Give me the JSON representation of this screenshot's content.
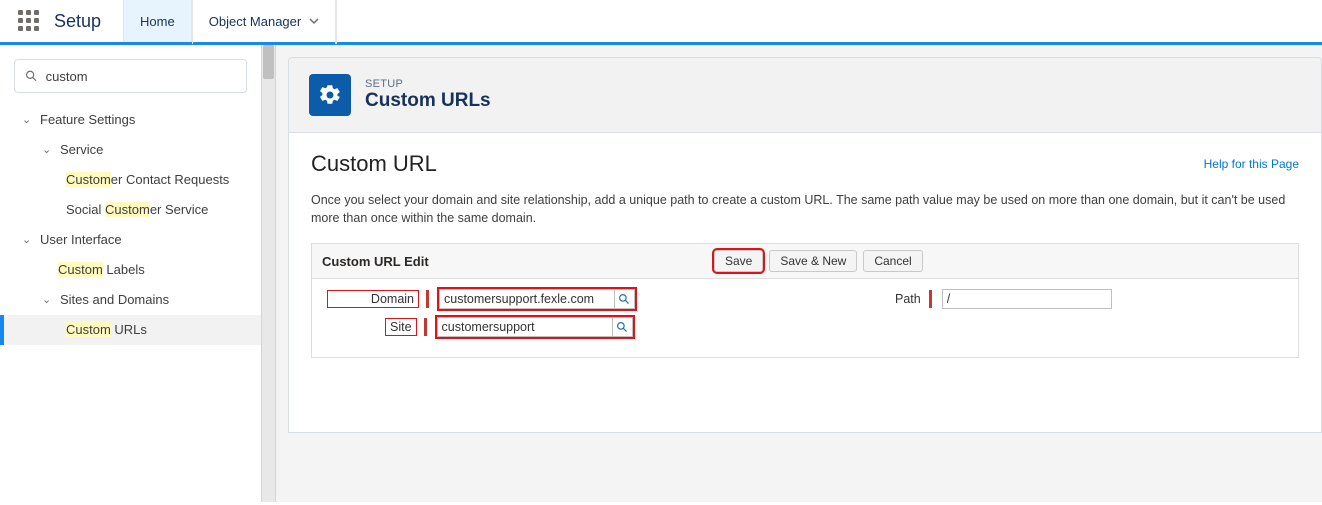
{
  "topbar": {
    "app_title": "Setup",
    "tab_home": "Home",
    "tab_object_manager": "Object Manager"
  },
  "sidebar": {
    "search_value": "custom",
    "tree": {
      "feature_settings": "Feature Settings",
      "service": "Service",
      "customer_contact_pre": "Custom",
      "customer_contact_post": "er Contact Requests",
      "social_pre": "Social ",
      "social_hl": "Custom",
      "social_post": "er Service",
      "user_interface": "User Interface",
      "custom_labels_hl": "Custom",
      "custom_labels_post": " Labels",
      "sites_domains": "Sites and Domains",
      "custom_urls_hl": "Custom",
      "custom_urls_post": " URLs"
    }
  },
  "header": {
    "eyebrow": "SETUP",
    "title": "Custom URLs"
  },
  "detail": {
    "section_title": "Custom URL",
    "help": "Help for this Page",
    "description": "Once you select your domain and site relationship, add a unique path to create a custom URL. The same path value may be used on more than one domain, but it can't be used more than once within the same domain.",
    "edit_title": "Custom URL Edit",
    "buttons": {
      "save": "Save",
      "save_new": "Save & New",
      "cancel": "Cancel"
    },
    "form": {
      "domain_label": "Domain",
      "domain_value": "customersupport.fexle.com",
      "site_label": "Site",
      "site_value": "customersupport",
      "path_label": "Path",
      "path_value": "/"
    }
  }
}
